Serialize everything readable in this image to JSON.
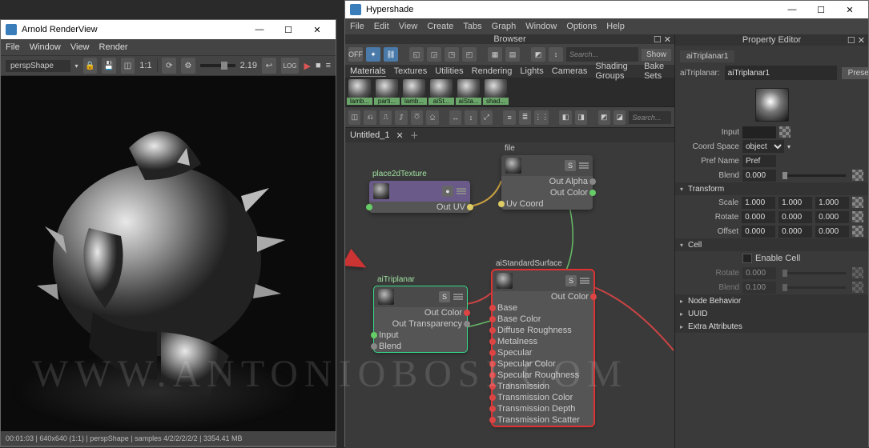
{
  "arv": {
    "title": "Arnold RenderView",
    "menu": [
      "File",
      "Window",
      "View",
      "Render"
    ],
    "camera": "perspShape",
    "scale_label": "1:1",
    "zoom_value": "2.19",
    "log_label": "LOG",
    "status": "00:01:03 | 640x640 (1:1) | perspShape | samples 4/2/2/2/2/2 | 3354.41 MB"
  },
  "hs": {
    "title": "Hypershade",
    "menu": [
      "File",
      "Edit",
      "View",
      "Create",
      "Tabs",
      "Graph",
      "Window",
      "Options",
      "Help"
    ],
    "browser_title": "Browser",
    "off_label": "OFF",
    "search_ph": "Search...",
    "show_label": "Show",
    "browser_tabs": [
      "Materials",
      "Textures",
      "Utilities",
      "Rendering",
      "Lights",
      "Cameras",
      "Shading Groups",
      "Bake Sets"
    ],
    "swatches": [
      "lamb...",
      "parti...",
      "lamb...",
      "aiSt...",
      "aiSta...",
      "shad..."
    ],
    "work_search": "Search...",
    "work_tab": "Untitled_1",
    "nodes": {
      "place2d": {
        "label": "place2dTexture",
        "out": "Out UV"
      },
      "file": {
        "label": "file",
        "out_alpha": "Out Alpha",
        "out_color": "Out Color",
        "in": "Uv Coord"
      },
      "aitri": {
        "label": "aiTriplanar",
        "out_color": "Out Color",
        "out_trans": "Out Transparency",
        "in_input": "Input",
        "in_blend": "Blend"
      },
      "aistd": {
        "label": "aiStandardSurface",
        "out_color": "Out Color",
        "attrs": [
          "Base",
          "Base Color",
          "Diffuse Roughness",
          "Metalness",
          "Specular",
          "Specular Color",
          "Specular Roughness",
          "Transmission",
          "Transmission Color",
          "Transmission Depth",
          "Transmission Scatter"
        ]
      }
    }
  },
  "pe": {
    "title": "Property Editor",
    "tab": "aiTriplanar1",
    "type_label": "aiTriplanar:",
    "name_value": "aiTriplanar1",
    "presets": "Presets",
    "rows": {
      "input": "Input",
      "coord_space": "Coord Space",
      "coord_space_val": "object",
      "pref_name": "Pref Name",
      "pref_val": "Pref",
      "blend": "Blend",
      "blend_val": "0.000"
    },
    "transform": "Transform",
    "scale": "Scale",
    "scale_vals": [
      "1.000",
      "1.000",
      "1.000"
    ],
    "rotate": "Rotate",
    "rotate_vals": [
      "0.000",
      "0.000",
      "0.000"
    ],
    "offset": "Offset",
    "offset_vals": [
      "0.000",
      "0.000",
      "0.000"
    ],
    "cell": "Cell",
    "enable_cell": "Enable Cell",
    "cell_rotate": "Rotate",
    "cell_rotate_val": "0.000",
    "cell_blend": "Blend",
    "cell_blend_val": "0.100",
    "sections": [
      "Node Behavior",
      "UUID",
      "Extra Attributes"
    ]
  },
  "watermark": "WWW.ANTONIOBOSI.COM"
}
